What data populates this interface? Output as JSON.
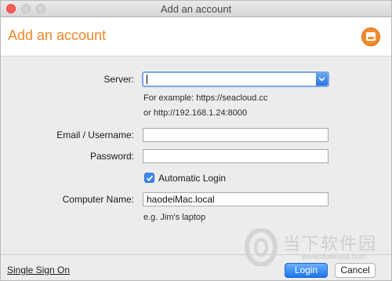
{
  "window": {
    "title": "Add an account"
  },
  "header": {
    "title": "Add an account",
    "logo_icon": "seafile-logo-icon"
  },
  "form": {
    "server": {
      "label": "Server:",
      "value": "",
      "hint_line1": "For example: https://seacloud.cc",
      "hint_line2": "or http://192.168.1.24:8000"
    },
    "email": {
      "label": "Email / Username:",
      "value": ""
    },
    "password": {
      "label": "Password:",
      "value": ""
    },
    "automatic_login": {
      "label": "Automatic Login",
      "checked": true
    },
    "computer_name": {
      "label": "Computer Name:",
      "value": "haodeiMac.local",
      "hint": "e.g. Jim's laptop"
    }
  },
  "footer": {
    "sso_link": "Single Sign On",
    "login_button": "Login",
    "cancel_button": "Cancel"
  },
  "watermark": {
    "text": "当下软件园",
    "url": "www.downxia.com"
  },
  "colors": {
    "accent": "#f0862a",
    "primary_button": "#1b75f0",
    "focus_ring": "#7aa7e5"
  }
}
